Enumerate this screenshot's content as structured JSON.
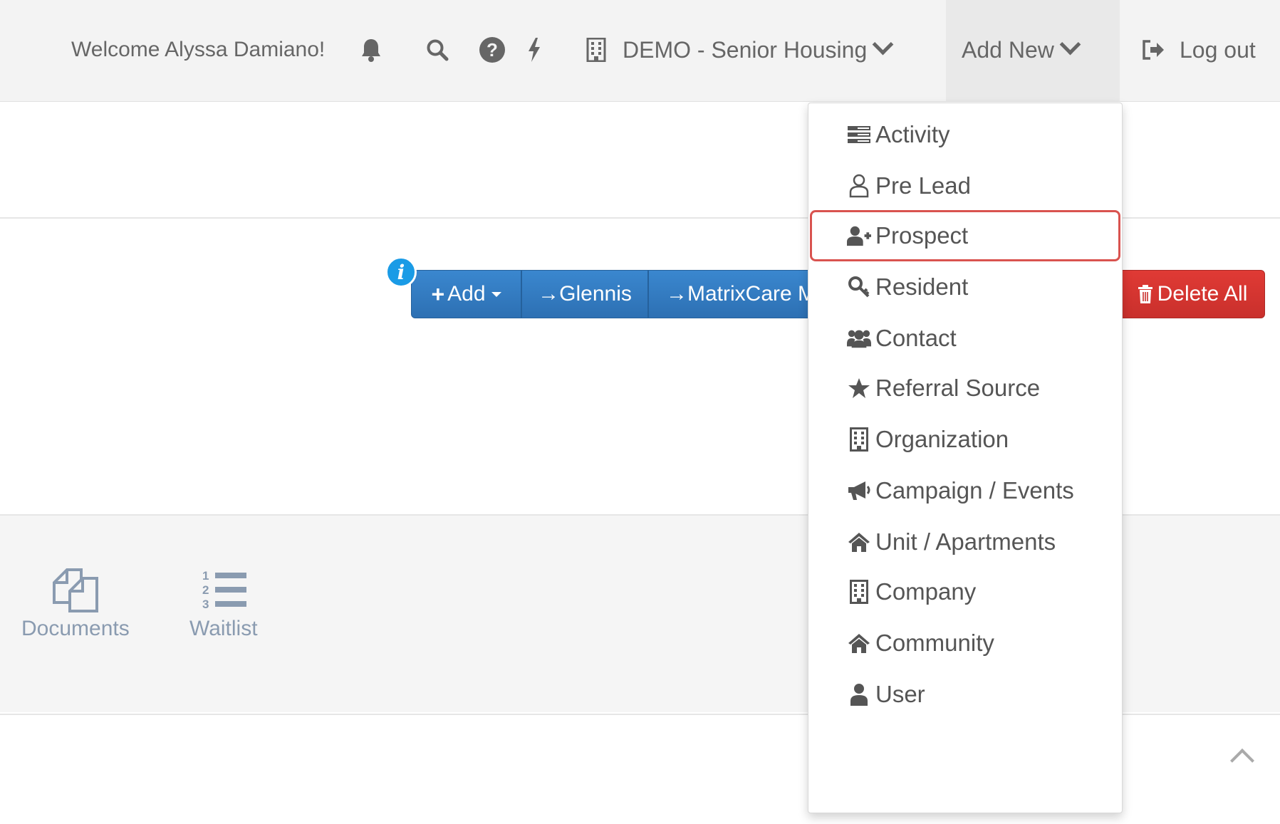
{
  "navbar": {
    "welcome": "Welcome Alyssa Damiano!",
    "icons": [
      "bell-icon",
      "search-icon",
      "help-icon",
      "bolt-icon",
      "building-icon"
    ],
    "org_selector": "DEMO - Senior Housing",
    "add_new": "Add New",
    "logout": "Log out"
  },
  "toolbar": {
    "info": "i",
    "add": "Add",
    "glennis": "→Glennis",
    "matrixcare": "→MatrixCare M",
    "delete_all": "Delete All"
  },
  "tiles": {
    "documents": "Documents",
    "waitlist": "Waitlist"
  },
  "dropdown": {
    "items": [
      {
        "label": "Activity",
        "icon": "activity-icon"
      },
      {
        "label": "Pre Lead",
        "icon": "user-outline-icon"
      },
      {
        "label": "Prospect",
        "icon": "user-plus-icon"
      },
      {
        "label": "Resident",
        "icon": "key-icon"
      },
      {
        "label": "Contact",
        "icon": "users-icon"
      },
      {
        "label": "Referral Source",
        "icon": "star-icon"
      },
      {
        "label": "Organization",
        "icon": "building-icon"
      },
      {
        "label": "Campaign / Events",
        "icon": "bullhorn-icon"
      },
      {
        "label": "Unit / Apartments",
        "icon": "home-icon"
      },
      {
        "label": "Company",
        "icon": "building-icon"
      },
      {
        "label": "Community",
        "icon": "home-icon"
      },
      {
        "label": "User",
        "icon": "user-icon"
      }
    ],
    "highlighted_index": 2
  },
  "colors": {
    "primary": "#337ab7",
    "danger": "#d9534f",
    "info": "#1a9be6",
    "highlight_outline": "#d9534f"
  }
}
